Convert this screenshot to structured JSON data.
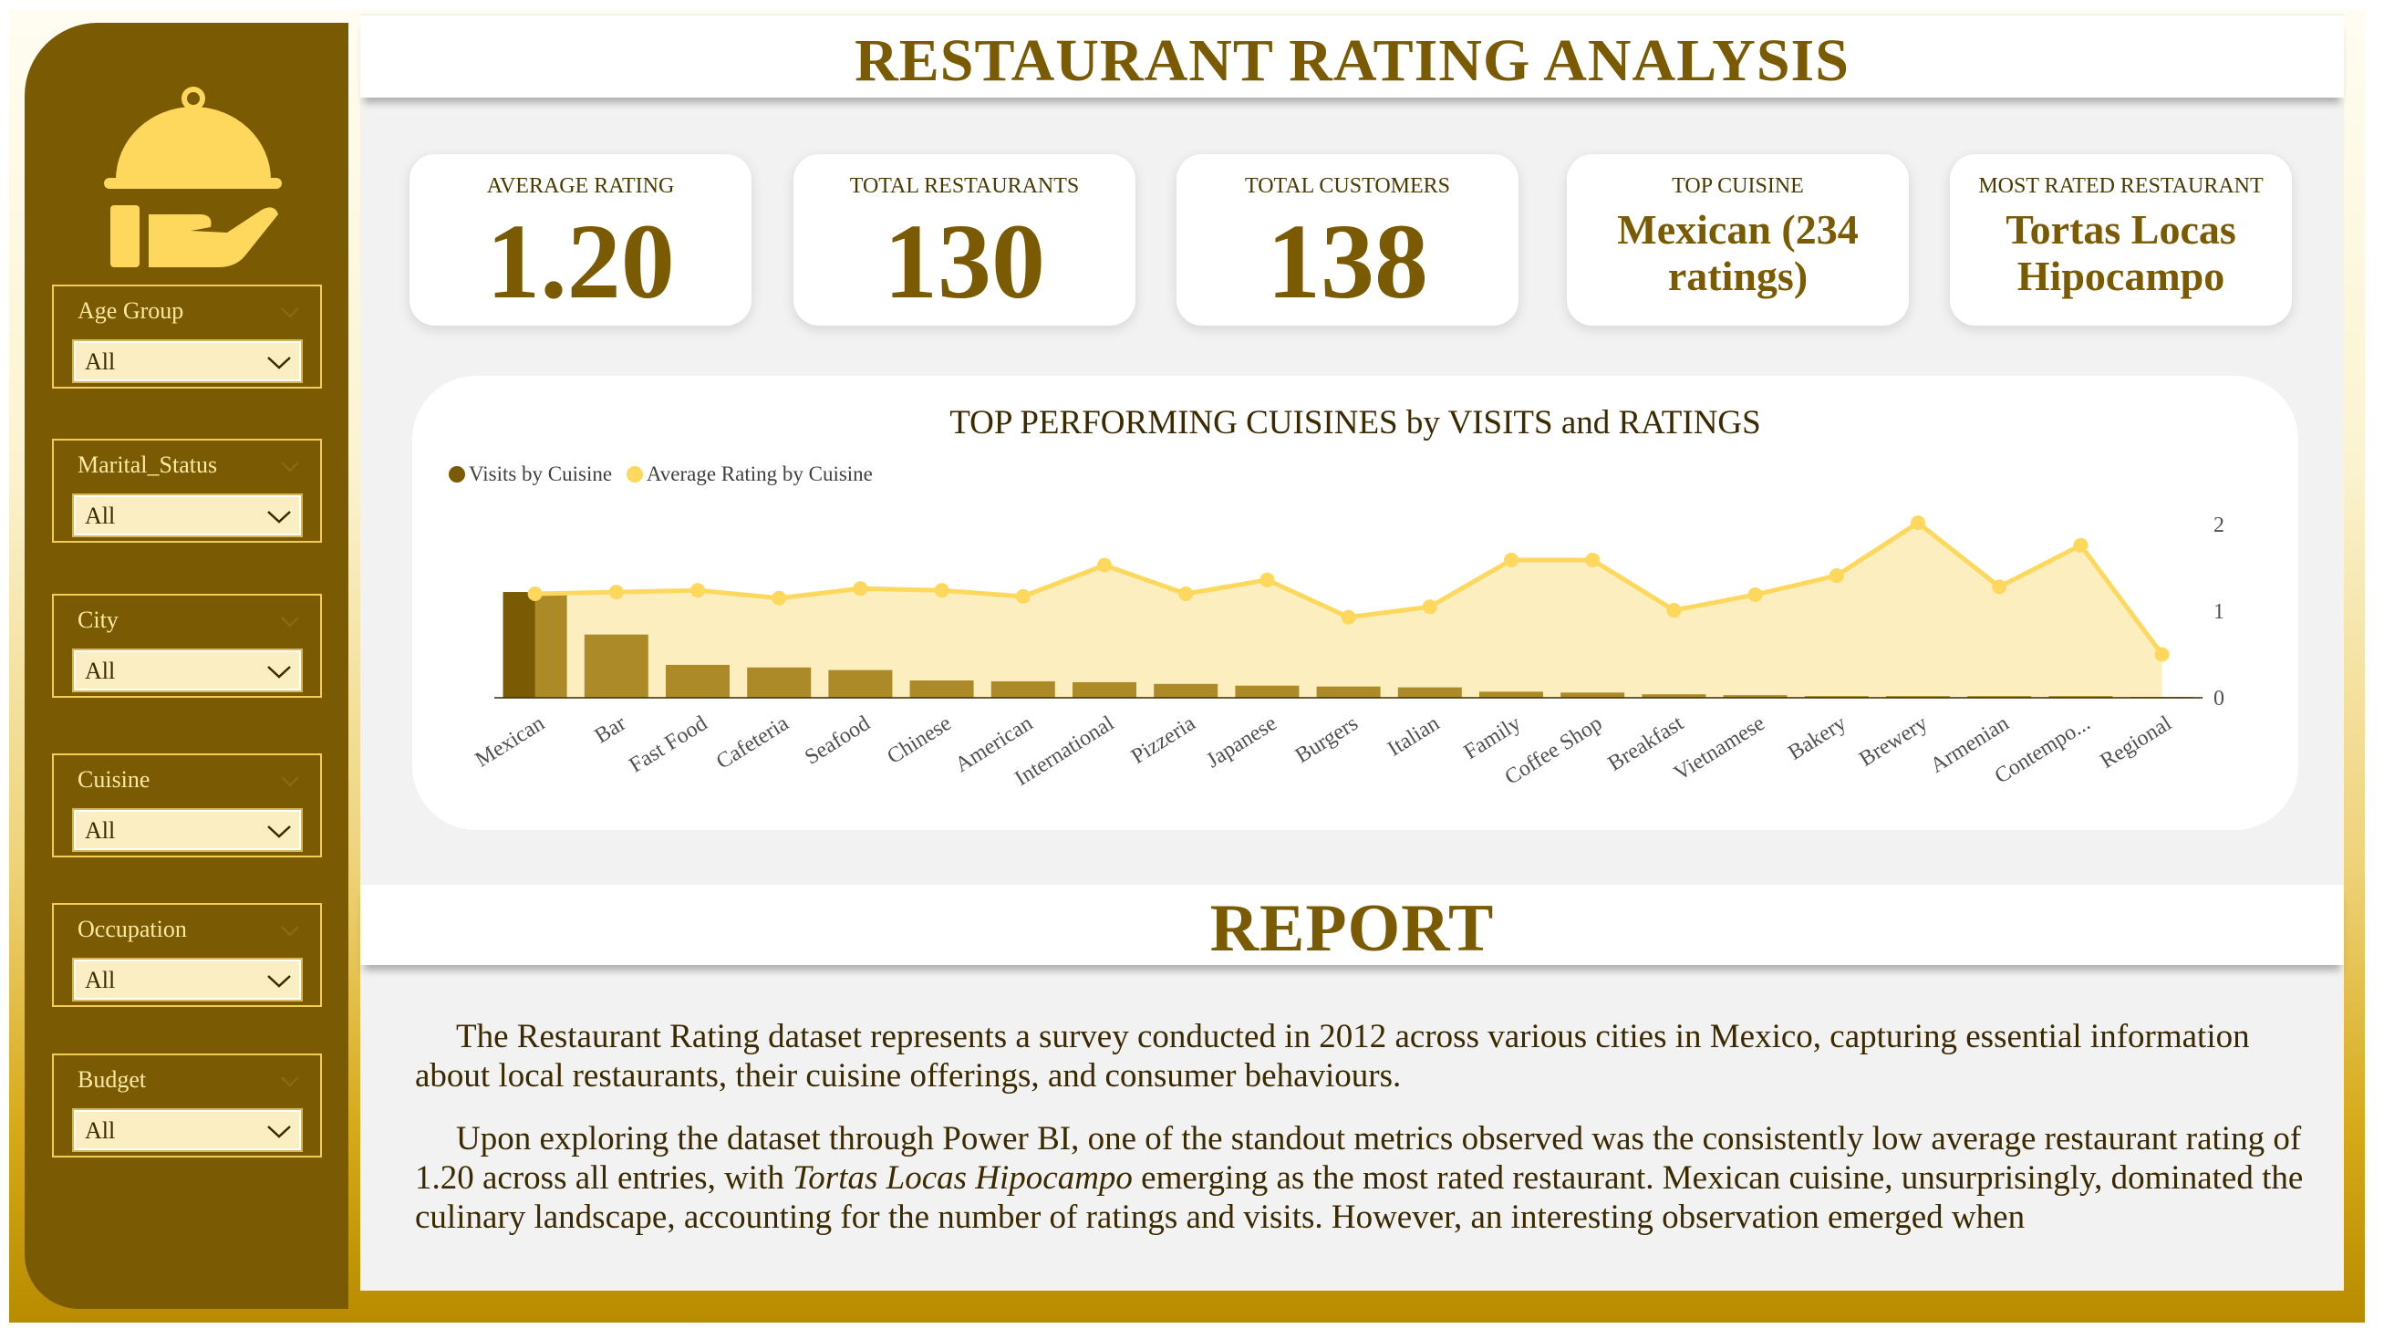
{
  "title": "RESTAURANT RATING ANALYSIS",
  "colors": {
    "primary": "#7a5a02",
    "accent": "#fdd85d",
    "slicer_bg": "#fbeec3",
    "visits_bar": "#ad8a28"
  },
  "sidebar": {
    "logo_icon": "serving-cloche-hand-icon",
    "slicers": [
      {
        "title": "Age Group",
        "value": "All"
      },
      {
        "title": "Marital_Status",
        "value": "All"
      },
      {
        "title": "City",
        "value": "All"
      },
      {
        "title": "Cuisine",
        "value": "All"
      },
      {
        "title": "Occupation",
        "value": "All"
      },
      {
        "title": "Budget",
        "value": "All"
      }
    ]
  },
  "kpis": [
    {
      "label": "AVERAGE RATING",
      "value": "1.20"
    },
    {
      "label": "TOTAL RESTAURANTS",
      "value": "130"
    },
    {
      "label": "TOTAL CUSTOMERS",
      "value": "138"
    },
    {
      "label": "TOP CUISINE",
      "value": "Mexican (234 ratings)"
    },
    {
      "label": "MOST RATED RESTAURANT",
      "value": "Tortas Locas Hipocampo"
    }
  ],
  "chart_data": {
    "type": "bar",
    "title": "TOP PERFORMING CUISINES by VISITS and RATINGS",
    "legend": "top-left",
    "categories": [
      "Mexican",
      "Bar",
      "Fast Food",
      "Cafeteria",
      "Seafood",
      "Chinese",
      "American",
      "International",
      "Pizzeria",
      "Japanese",
      "Burgers",
      "Italian",
      "Family",
      "Coffee Shop",
      "Breakfast",
      "Vietnamese",
      "Bakery",
      "Brewery",
      "Armenian",
      "Contempo...",
      "Regional"
    ],
    "series": [
      {
        "name": "Visits by Cuisine",
        "type": "bar",
        "color": "#7a5a02",
        "values": [
          1.22,
          0.73,
          0.38,
          0.35,
          0.32,
          0.2,
          0.19,
          0.18,
          0.16,
          0.14,
          0.13,
          0.12,
          0.07,
          0.06,
          0.04,
          0.03,
          0.02,
          0.02,
          0.02,
          0.02,
          0.01
        ]
      },
      {
        "name": "Average Rating by Cuisine",
        "type": "area",
        "color": "#fdd85d",
        "values": [
          1.2,
          1.22,
          1.24,
          1.15,
          1.26,
          1.24,
          1.17,
          1.53,
          1.2,
          1.36,
          0.93,
          1.05,
          1.59,
          1.59,
          1.01,
          1.19,
          1.41,
          2.02,
          1.28,
          1.76,
          0.5
        ]
      }
    ],
    "y2_ticks": [
      "0",
      "1",
      "2"
    ],
    "ylim": [
      0,
      2
    ]
  },
  "report": {
    "title": "REPORT",
    "p1": "The Restaurant Rating dataset represents a survey conducted in 2012 across various cities in Mexico, capturing essential information about local restaurants, their cuisine offerings, and consumer behaviours.",
    "p2_a": "Upon exploring the dataset through Power BI, one of the standout metrics observed was the consistently low average restaurant rating of 1.20 across all entries, with ",
    "p2_italic": "Tortas Locas Hipocampo",
    "p2_b": " emerging as the most rated restaurant. Mexican cuisine, unsurprisingly, dominated the culinary landscape, accounting for  the number of ratings and visits. However, an interesting observation emerged when"
  }
}
